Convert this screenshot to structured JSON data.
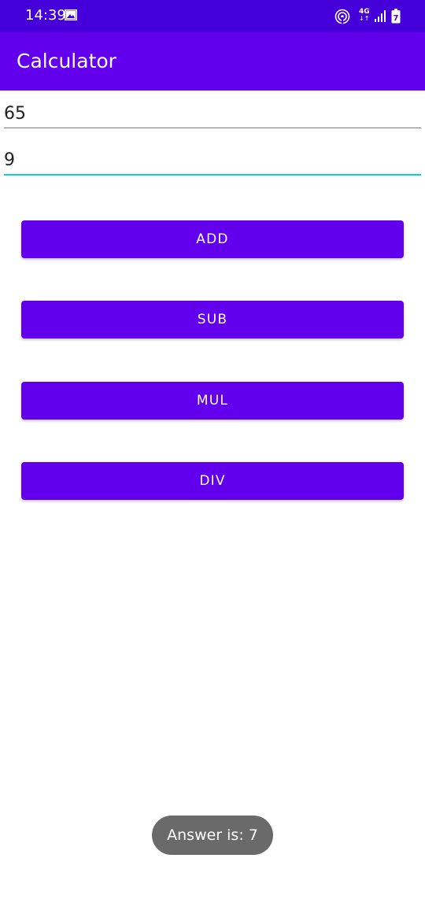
{
  "status_bar": {
    "time": "14:39",
    "network": "4G",
    "network_arrows": "↓↑",
    "icons": [
      "gallery-icon",
      "hotspot-icon",
      "signal-icon",
      "battery-icon"
    ],
    "battery_level": "7"
  },
  "app_bar": {
    "title": "Calculator"
  },
  "inputs": {
    "first_value": "65",
    "second_value": "9"
  },
  "buttons": {
    "add": "ADD",
    "sub": "SUB",
    "mul": "MUL",
    "div": "DIV"
  },
  "toast": {
    "message": "Answer is: 7"
  },
  "colors": {
    "status_bar": "#4500d9",
    "primary": "#6200ee",
    "accent": "#03dac5",
    "toast_bg": "#6a6a6a"
  }
}
